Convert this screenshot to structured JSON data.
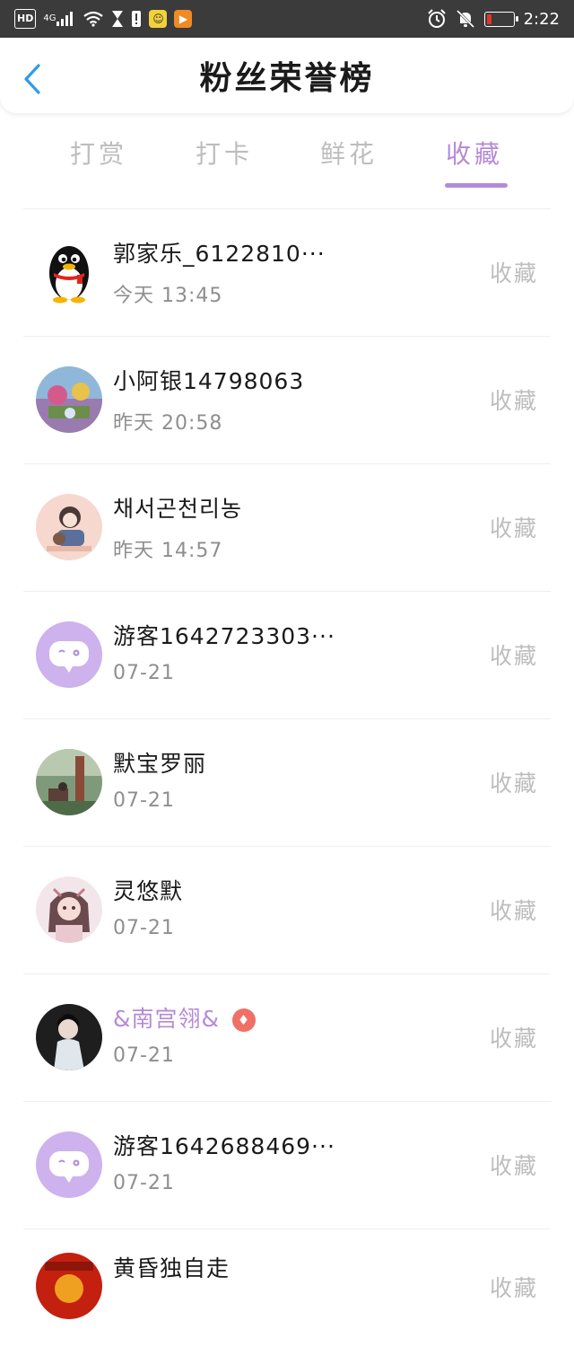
{
  "status_bar": {
    "hd": "HD",
    "network": "4G",
    "time": "2:22"
  },
  "header": {
    "title": "粉丝荣誉榜"
  },
  "tabs": [
    {
      "label": "打赏",
      "active": false
    },
    {
      "label": "打卡",
      "active": false
    },
    {
      "label": "鲜花",
      "active": false
    },
    {
      "label": "收藏",
      "active": true
    }
  ],
  "accent_color": "#b58ad9",
  "fans": [
    {
      "name": "郭家乐_6122810···",
      "time": "今天 13:45",
      "action": "收藏",
      "avatar": "qq-penguin-icon"
    },
    {
      "name": "小阿银14798063",
      "time": "昨天 20:58",
      "action": "收藏",
      "avatar": "photo-avatar"
    },
    {
      "name": "채서곤천리농",
      "time": "昨天 14:57",
      "action": "收藏",
      "avatar": "photo-avatar"
    },
    {
      "name": "游客1642723303···",
      "time": "07-21",
      "action": "收藏",
      "avatar": "guest-chat-icon"
    },
    {
      "name": "默宝罗丽",
      "time": "07-21",
      "action": "收藏",
      "avatar": "photo-avatar"
    },
    {
      "name": "灵悠默",
      "time": "07-21",
      "action": "收藏",
      "avatar": "photo-avatar"
    },
    {
      "name": "&南宫翎&",
      "time": "07-21",
      "action": "收藏",
      "avatar": "photo-avatar",
      "vip": true
    },
    {
      "name": "游客1642688469···",
      "time": "07-21",
      "action": "收藏",
      "avatar": "guest-chat-icon"
    },
    {
      "name": "黄昏独自走",
      "time": "",
      "action": "收藏",
      "avatar": "photo-avatar"
    }
  ]
}
